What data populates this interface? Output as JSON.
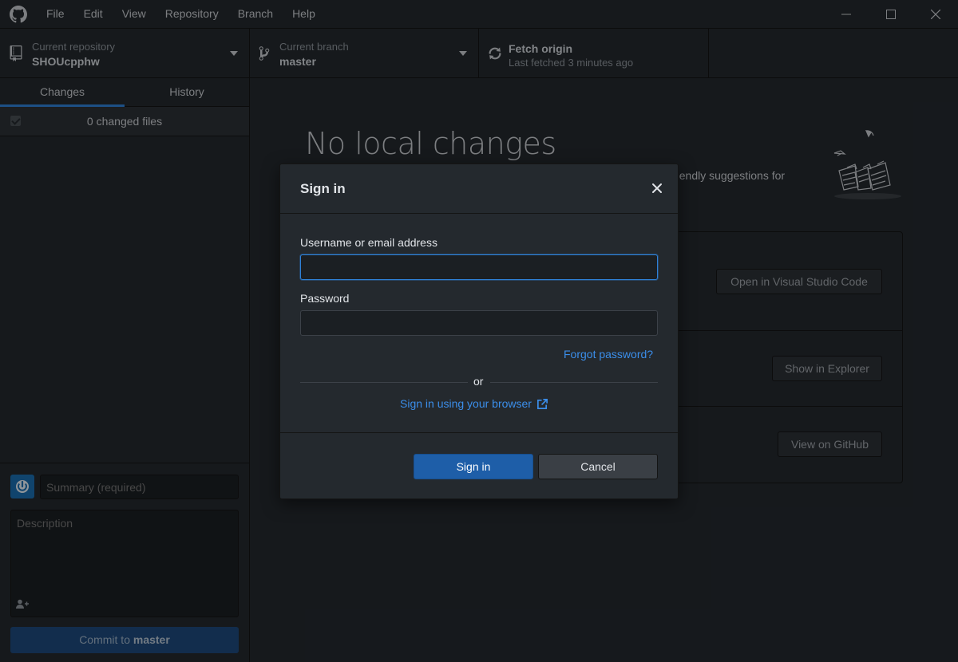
{
  "menu": [
    "File",
    "Edit",
    "View",
    "Repository",
    "Branch",
    "Help"
  ],
  "toolbar": {
    "repo_caption": "Current repository",
    "repo_name": "SHOUcpphw",
    "branch_caption": "Current branch",
    "branch_name": "master",
    "fetch_title": "Fetch origin",
    "fetch_subtitle": "Last fetched 3 minutes ago"
  },
  "sidebar": {
    "tabs": [
      "Changes",
      "History"
    ],
    "changed_files": "0 changed files",
    "summary_placeholder": "Summary (required)",
    "description_placeholder": "Description",
    "commit_prefix": "Commit to ",
    "commit_branch": "master"
  },
  "main": {
    "heading": "No local changes",
    "suggestion_fragment": "riendly suggestions for",
    "actions": [
      "Open in Visual Studio Code",
      "Show in Explorer",
      "View on GitHub"
    ]
  },
  "dialog": {
    "title": "Sign in",
    "username_label": "Username or email address",
    "username_value": "",
    "password_label": "Password",
    "password_value": "",
    "forgot": "Forgot password?",
    "or": "or",
    "browser_link": "Sign in using your browser",
    "sign_in": "Sign in",
    "cancel": "Cancel"
  },
  "colors": {
    "accent": "#2f81d7",
    "link": "#3b8eea",
    "primary_button": "#1e5ea8",
    "background": "#24292e"
  },
  "icons": [
    "github-logo-icon",
    "minimize-icon",
    "maximize-icon",
    "close-window-icon",
    "repo-icon",
    "branch-icon",
    "sync-icon",
    "caret-down-icon",
    "checkbox-icon",
    "avatar-icon",
    "add-coauthor-icon",
    "close-icon",
    "external-link-icon"
  ]
}
